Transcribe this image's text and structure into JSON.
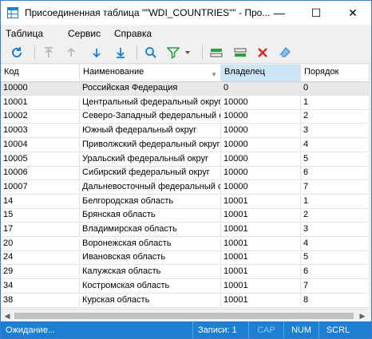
{
  "window": {
    "title": "Присоединенная таблица \"\"WDI_COUNTRIES\"\" - Про...",
    "controls": {
      "minimize": "—",
      "maximize": "☐",
      "close": "✕"
    }
  },
  "menu": [
    "Таблица",
    "Сервис",
    "Справка"
  ],
  "toolbar": {
    "icons": [
      "refresh-icon",
      "first-icon",
      "prev-icon",
      "next-icon",
      "last-icon",
      "search-icon",
      "filter-icon",
      "insert-row-icon",
      "add-row-icon",
      "delete-icon",
      "eraser-icon"
    ],
    "colors": {
      "accent": "#1c7fd1",
      "green": "#2e9e3e",
      "red": "#d9262c"
    }
  },
  "table": {
    "columns": [
      "Код",
      "Наименование",
      "Владелец",
      "Порядок"
    ],
    "rows": [
      [
        "10000",
        "Российская Федерация",
        "0",
        "0"
      ],
      [
        "10001",
        "Центральный федеральный округ",
        "10000",
        "1"
      ],
      [
        "10002",
        "Северо-Западный федеральный округ",
        "10000",
        "2"
      ],
      [
        "10003",
        "Южный федеральный округ",
        "10000",
        "3"
      ],
      [
        "10004",
        "Приволжский федеральный округ",
        "10000",
        "4"
      ],
      [
        "10005",
        "Уральский федеральный округ",
        "10000",
        "5"
      ],
      [
        "10006",
        "Сибирский федеральный округ",
        "10000",
        "6"
      ],
      [
        "10007",
        "Дальневосточный федеральный округ",
        "10000",
        "7"
      ],
      [
        "14",
        "Белгородская область",
        "10001",
        "1"
      ],
      [
        "15",
        "Брянская область",
        "10001",
        "2"
      ],
      [
        "17",
        "Владимирская область",
        "10001",
        "3"
      ],
      [
        "20",
        "Воронежская область",
        "10001",
        "4"
      ],
      [
        "24",
        "Ивановская область",
        "10001",
        "5"
      ],
      [
        "29",
        "Калужская область",
        "10001",
        "6"
      ],
      [
        "34",
        "Костромская область",
        "10001",
        "7"
      ],
      [
        "38",
        "Курская область",
        "10001",
        "8"
      ]
    ]
  },
  "status": {
    "state": "Ожидание...",
    "records": "Записи: 1",
    "cap": "CAP",
    "num": "NUM",
    "scrl": "SCRL"
  }
}
